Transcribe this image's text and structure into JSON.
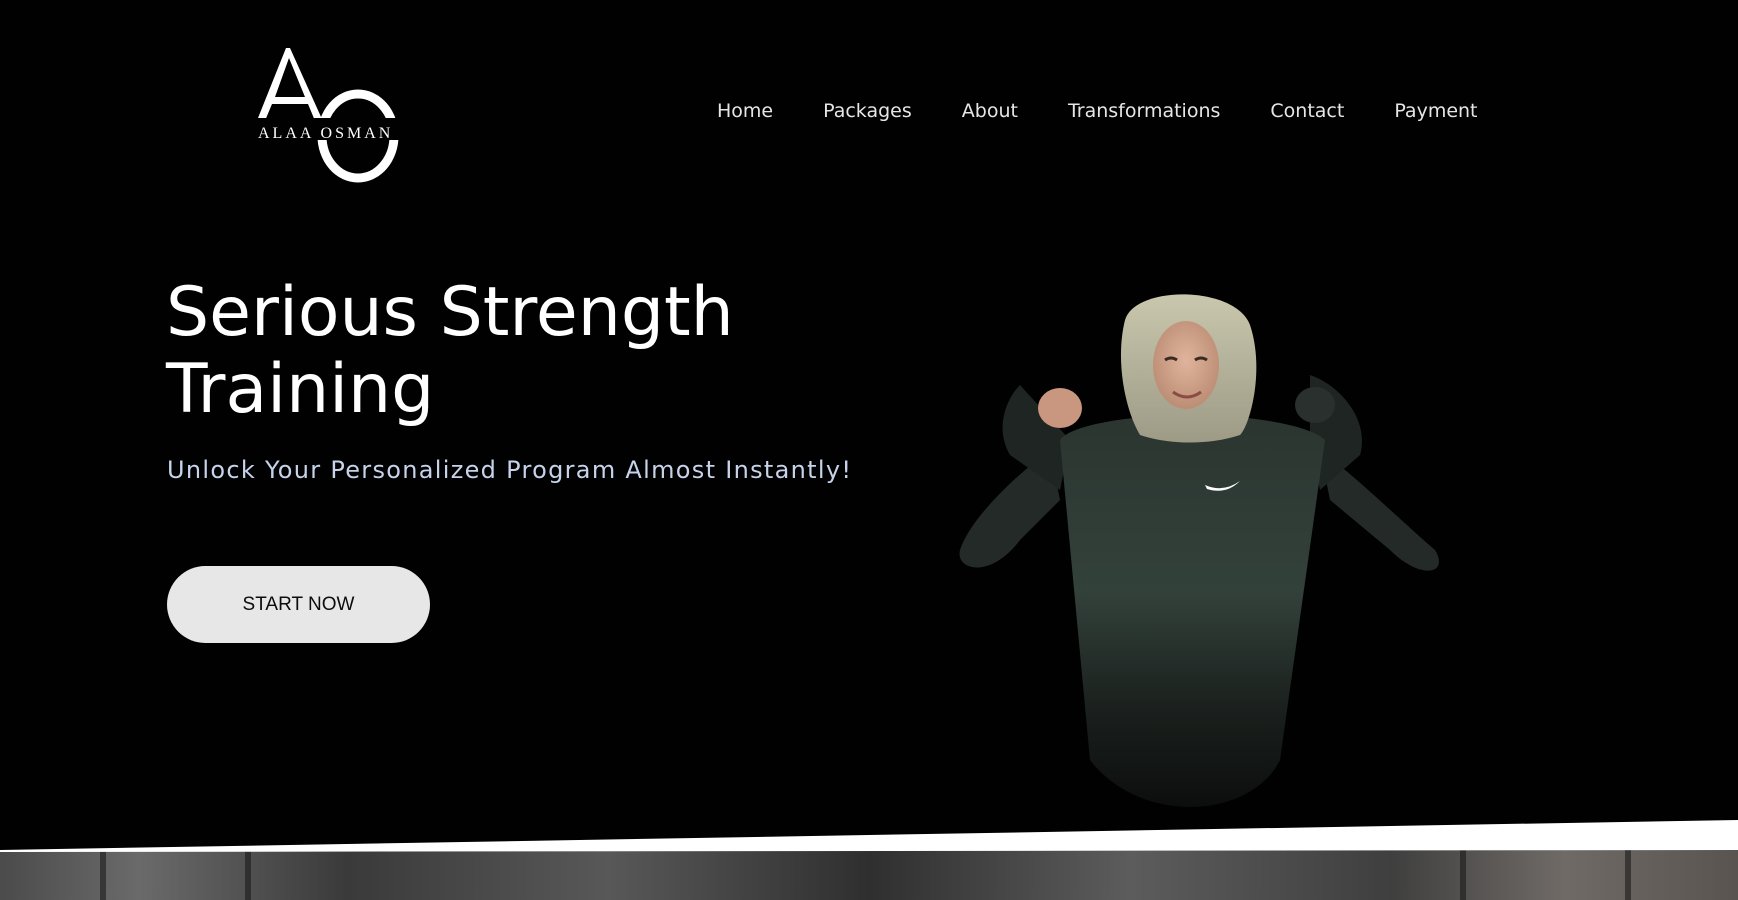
{
  "brand": {
    "monogram": "AO",
    "name": "ALAA OSMAN"
  },
  "nav": {
    "items": [
      {
        "label": "Home"
      },
      {
        "label": "Packages"
      },
      {
        "label": "About"
      },
      {
        "label": "Transformations"
      },
      {
        "label": "Contact"
      },
      {
        "label": "Payment"
      }
    ]
  },
  "hero": {
    "title_line1": "Serious Strength",
    "title_line2": "Training",
    "subtitle": "Unlock Your Personalized Program Almost Instantly!",
    "cta_label": "START NOW"
  },
  "colors": {
    "background": "#010101",
    "text": "#ffffff",
    "subtitle": "#c7d3ea",
    "cta_bg": "#e7e7e7",
    "cta_text": "#0d0d0d"
  },
  "icons": {
    "hero_image": "woman-flexing-photo",
    "brand_mark": "ao-monogram-logo"
  }
}
